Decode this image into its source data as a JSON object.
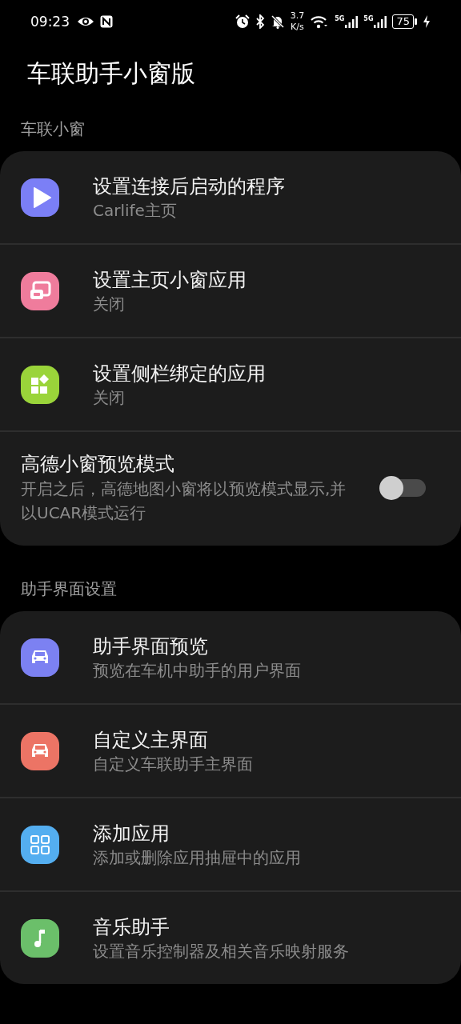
{
  "status_bar": {
    "time": "09:23",
    "speed_value": "3.7",
    "speed_unit": "K/s",
    "networks": [
      {
        "label": "5G"
      },
      {
        "label": "5G"
      }
    ],
    "battery": "75"
  },
  "title": "车联助手小窗版",
  "sections": [
    {
      "header": "车联小窗",
      "items": [
        {
          "kind": "link",
          "title": "设置连接后启动的程序",
          "subtitle": "Carlife主页",
          "color": "#7b7ff6"
        },
        {
          "kind": "link",
          "title": "设置主页小窗应用",
          "subtitle": "关闭",
          "color": "#ef7c9c"
        },
        {
          "kind": "link",
          "title": "设置侧栏绑定的应用",
          "subtitle": "关闭",
          "color": "#9ad43a"
        },
        {
          "kind": "switch",
          "title": "高德小窗预览模式",
          "subtitle": "开启之后，高德地图小窗将以预览模式显示,并以UCAR模式运行",
          "on": false
        }
      ]
    },
    {
      "header": "助手界面设置",
      "items": [
        {
          "kind": "link",
          "title": "助手界面预览",
          "subtitle": "预览在车机中助手的用户界面",
          "color": "#7c81f2"
        },
        {
          "kind": "link",
          "title": "自定义主界面",
          "subtitle": "自定义车联助手主界面",
          "color": "#ec7465"
        },
        {
          "kind": "link",
          "title": "添加应用",
          "subtitle": "添加或删除应用抽屉中的应用",
          "color": "#54aef0"
        },
        {
          "kind": "link",
          "title": "音乐助手",
          "subtitle": "设置音乐控制器及相关音乐映射服务",
          "color": "#6bbf6a"
        }
      ]
    }
  ]
}
